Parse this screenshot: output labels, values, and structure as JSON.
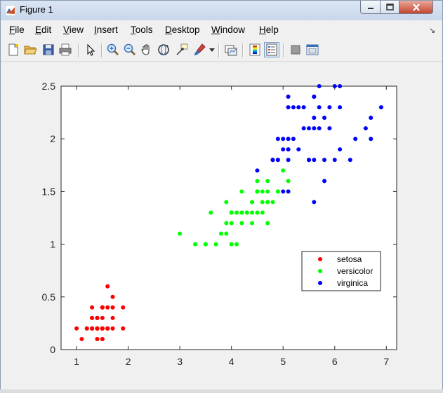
{
  "window": {
    "title": "Figure 1"
  },
  "menu": [
    {
      "label": "File",
      "u": "F",
      "rest": "ile"
    },
    {
      "label": "Edit",
      "u": "E",
      "rest": "dit"
    },
    {
      "label": "View",
      "u": "V",
      "rest": "iew"
    },
    {
      "label": "Insert",
      "u": "I",
      "rest": "nsert"
    },
    {
      "label": "Tools",
      "u": "T",
      "rest": "ools"
    },
    {
      "label": "Desktop",
      "u": "D",
      "rest": "esktop"
    },
    {
      "label": "Window",
      "u": "W",
      "rest": "indow"
    },
    {
      "label": "Help",
      "u": "H",
      "rest": "elp"
    }
  ],
  "toolbar": {
    "icons": [
      "new-figure-icon",
      "open-file-icon",
      "save-icon",
      "print-icon",
      "pointer-icon",
      "zoom-in-icon",
      "zoom-out-icon",
      "pan-hand-icon",
      "rotate-3d-icon",
      "data-cursor-icon",
      "brush-icon",
      "link-plot-icon",
      "colorbar-icon",
      "legend-icon",
      "hide-plot-tools-icon",
      "show-plot-tools-icon"
    ],
    "pressed": "legend-icon"
  },
  "colors": {
    "setosa": "#ff0000",
    "versicolor": "#00ff00",
    "virginica": "#0000ff"
  },
  "chart_data": {
    "type": "scatter",
    "xlim": [
      0.7,
      7.2
    ],
    "ylim": [
      0,
      2.5
    ],
    "xticks": [
      "1",
      "2",
      "3",
      "4",
      "5",
      "6",
      "7"
    ],
    "yticks": [
      "0",
      "0.5",
      "1",
      "1.5",
      "2",
      "2.5"
    ],
    "xtick_values": [
      1,
      2,
      3,
      4,
      5,
      6,
      7
    ],
    "ytick_values": [
      0,
      0.5,
      1,
      1.5,
      2,
      2.5
    ],
    "grid": false,
    "legend_position": "inside-right",
    "series": [
      {
        "name": "setosa",
        "color": "#ff0000",
        "points": [
          [
            1.4,
            0.2
          ],
          [
            1.4,
            0.2
          ],
          [
            1.3,
            0.2
          ],
          [
            1.5,
            0.2
          ],
          [
            1.4,
            0.2
          ],
          [
            1.7,
            0.4
          ],
          [
            1.4,
            0.3
          ],
          [
            1.5,
            0.2
          ],
          [
            1.4,
            0.2
          ],
          [
            1.5,
            0.1
          ],
          [
            1.5,
            0.2
          ],
          [
            1.6,
            0.2
          ],
          [
            1.4,
            0.1
          ],
          [
            1.1,
            0.1
          ],
          [
            1.2,
            0.2
          ],
          [
            1.5,
            0.4
          ],
          [
            1.3,
            0.4
          ],
          [
            1.4,
            0.3
          ],
          [
            1.7,
            0.3
          ],
          [
            1.5,
            0.3
          ],
          [
            1.7,
            0.2
          ],
          [
            1.5,
            0.4
          ],
          [
            1.0,
            0.2
          ],
          [
            1.7,
            0.5
          ],
          [
            1.9,
            0.2
          ],
          [
            1.6,
            0.2
          ],
          [
            1.6,
            0.4
          ],
          [
            1.5,
            0.2
          ],
          [
            1.4,
            0.2
          ],
          [
            1.6,
            0.2
          ],
          [
            1.6,
            0.2
          ],
          [
            1.5,
            0.4
          ],
          [
            1.5,
            0.1
          ],
          [
            1.4,
            0.2
          ],
          [
            1.5,
            0.2
          ],
          [
            1.2,
            0.2
          ],
          [
            1.3,
            0.2
          ],
          [
            1.4,
            0.1
          ],
          [
            1.3,
            0.2
          ],
          [
            1.5,
            0.2
          ],
          [
            1.3,
            0.3
          ],
          [
            1.3,
            0.3
          ],
          [
            1.3,
            0.2
          ],
          [
            1.6,
            0.6
          ],
          [
            1.9,
            0.4
          ],
          [
            1.4,
            0.3
          ],
          [
            1.6,
            0.2
          ],
          [
            1.4,
            0.2
          ],
          [
            1.5,
            0.2
          ],
          [
            1.4,
            0.2
          ]
        ]
      },
      {
        "name": "versicolor",
        "color": "#00ff00",
        "points": [
          [
            4.7,
            1.4
          ],
          [
            4.5,
            1.5
          ],
          [
            4.9,
            1.5
          ],
          [
            4.0,
            1.3
          ],
          [
            4.6,
            1.5
          ],
          [
            4.5,
            1.3
          ],
          [
            4.7,
            1.6
          ],
          [
            3.3,
            1.0
          ],
          [
            4.6,
            1.3
          ],
          [
            3.9,
            1.4
          ],
          [
            3.5,
            1.0
          ],
          [
            4.2,
            1.5
          ],
          [
            4.0,
            1.0
          ],
          [
            4.7,
            1.4
          ],
          [
            3.6,
            1.3
          ],
          [
            4.4,
            1.4
          ],
          [
            4.5,
            1.5
          ],
          [
            4.1,
            1.0
          ],
          [
            4.5,
            1.5
          ],
          [
            3.9,
            1.1
          ],
          [
            4.8,
            1.8
          ],
          [
            4.0,
            1.3
          ],
          [
            4.9,
            1.5
          ],
          [
            4.7,
            1.2
          ],
          [
            4.3,
            1.3
          ],
          [
            4.4,
            1.4
          ],
          [
            4.8,
            1.4
          ],
          [
            5.0,
            1.7
          ],
          [
            4.5,
            1.5
          ],
          [
            3.5,
            1.0
          ],
          [
            3.8,
            1.1
          ],
          [
            3.7,
            1.0
          ],
          [
            3.9,
            1.2
          ],
          [
            5.1,
            1.6
          ],
          [
            4.5,
            1.5
          ],
          [
            4.5,
            1.6
          ],
          [
            4.7,
            1.5
          ],
          [
            4.4,
            1.3
          ],
          [
            4.1,
            1.3
          ],
          [
            4.0,
            1.3
          ],
          [
            4.4,
            1.2
          ],
          [
            4.6,
            1.4
          ],
          [
            4.0,
            1.2
          ],
          [
            3.3,
            1.0
          ],
          [
            4.2,
            1.3
          ],
          [
            4.2,
            1.2
          ],
          [
            4.2,
            1.3
          ],
          [
            4.3,
            1.3
          ],
          [
            3.0,
            1.1
          ],
          [
            4.1,
            1.3
          ]
        ]
      },
      {
        "name": "virginica",
        "color": "#0000ff",
        "points": [
          [
            6.0,
            2.5
          ],
          [
            5.1,
            1.9
          ],
          [
            5.9,
            2.1
          ],
          [
            5.6,
            1.8
          ],
          [
            5.8,
            2.2
          ],
          [
            6.6,
            2.1
          ],
          [
            4.5,
            1.7
          ],
          [
            6.3,
            1.8
          ],
          [
            5.8,
            1.8
          ],
          [
            6.1,
            2.5
          ],
          [
            5.1,
            2.0
          ],
          [
            5.3,
            1.9
          ],
          [
            5.5,
            2.1
          ],
          [
            5.0,
            2.0
          ],
          [
            5.1,
            2.4
          ],
          [
            5.3,
            2.3
          ],
          [
            5.5,
            1.8
          ],
          [
            6.7,
            2.2
          ],
          [
            6.9,
            2.3
          ],
          [
            5.0,
            1.5
          ],
          [
            5.7,
            2.3
          ],
          [
            4.9,
            2.0
          ],
          [
            6.7,
            2.0
          ],
          [
            4.9,
            1.8
          ],
          [
            5.7,
            2.1
          ],
          [
            6.0,
            1.8
          ],
          [
            4.8,
            1.8
          ],
          [
            4.9,
            1.8
          ],
          [
            5.6,
            2.1
          ],
          [
            5.8,
            1.6
          ],
          [
            6.1,
            1.9
          ],
          [
            6.4,
            2.0
          ],
          [
            5.6,
            2.2
          ],
          [
            5.1,
            1.5
          ],
          [
            5.6,
            1.4
          ],
          [
            6.1,
            2.3
          ],
          [
            5.6,
            2.4
          ],
          [
            5.5,
            1.8
          ],
          [
            4.8,
            1.8
          ],
          [
            5.4,
            2.1
          ],
          [
            5.6,
            2.4
          ],
          [
            5.1,
            2.3
          ],
          [
            5.1,
            1.9
          ],
          [
            5.9,
            2.3
          ],
          [
            5.7,
            2.5
          ],
          [
            5.2,
            2.3
          ],
          [
            5.0,
            1.9
          ],
          [
            5.2,
            2.0
          ],
          [
            5.4,
            2.3
          ],
          [
            5.1,
            1.8
          ]
        ]
      }
    ]
  }
}
